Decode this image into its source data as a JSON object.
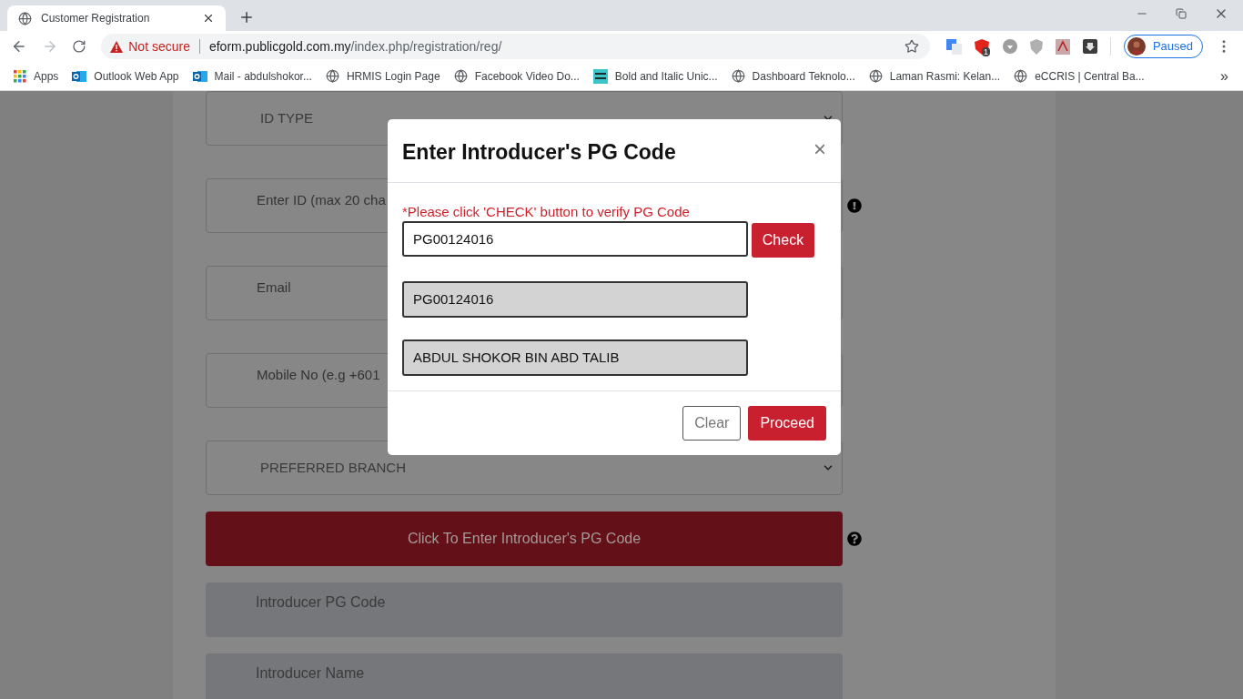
{
  "browser": {
    "tab": {
      "title": "Customer Registration",
      "selected": true
    },
    "address": {
      "security": "Not secure",
      "host": "eform.publicgold.com.my",
      "path": "/index.php/registration/reg/"
    },
    "extension_badge": "1",
    "profile": "Paused",
    "bookmarks": [
      {
        "label": "Apps",
        "kind": "apps"
      },
      {
        "label": "Outlook Web App",
        "kind": "outlook"
      },
      {
        "label": "Mail - abdulshokor...",
        "kind": "outlook"
      },
      {
        "label": "HRMIS Login Page",
        "kind": "globe"
      },
      {
        "label": "Facebook Video Do...",
        "kind": "globe"
      },
      {
        "label": "Bold and Italic Unic...",
        "kind": "logo"
      },
      {
        "label": "Dashboard Teknolo...",
        "kind": "globe"
      },
      {
        "label": "Laman Rasmi: Kelan...",
        "kind": "globe"
      },
      {
        "label": "eCCRIS | Central Ba...",
        "kind": "globe"
      }
    ],
    "more": "»"
  },
  "form": [
    {
      "kind": "select",
      "text": "ID TYPE",
      "hint": false
    },
    {
      "kind": "input",
      "text": "Enter ID (max 20 cha",
      "hint": true
    },
    {
      "kind": "input",
      "text": "Email",
      "hint": false
    },
    {
      "kind": "input",
      "text": "Mobile No (e.g +601",
      "hint": false
    },
    {
      "kind": "select",
      "text": "PREFERRED BRANCH",
      "hint": false
    },
    {
      "kind": "button",
      "text": "Click To Enter Introducer's PG Code",
      "hint": true
    },
    {
      "kind": "readonly",
      "text": "Introducer PG Code",
      "hint": false
    },
    {
      "kind": "readonly",
      "text": "Introducer Name",
      "hint": false
    }
  ],
  "modal": {
    "title": "Enter Introducer's PG Code",
    "close": "×",
    "notice": "*Please click 'CHECK' button to verify PG Code",
    "code_value": "PG00124016",
    "check_button": "Check",
    "results": [
      "PG00124016",
      "ABDUL SHOKOR BIN ABD TALIB"
    ],
    "buttons": [
      {
        "label": "Clear",
        "kind": "outline"
      },
      {
        "label": "Proceed",
        "kind": "primary"
      }
    ]
  }
}
